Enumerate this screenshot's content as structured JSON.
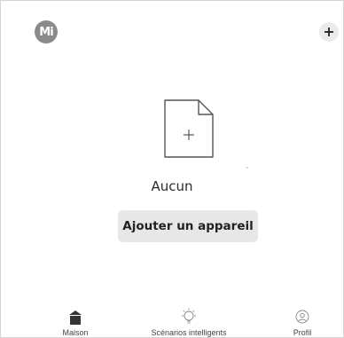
{
  "header": {
    "avatar_initials": "Mi",
    "add_icon": "plus-icon"
  },
  "empty_state": {
    "icon": "new-file-icon",
    "title": "Aucun",
    "button_label": "Ajouter un appareil"
  },
  "bottom_nav": {
    "items": [
      {
        "icon": "home-icon",
        "label": "Maison",
        "active": true
      },
      {
        "icon": "lightbulb-icon",
        "label": "Scénarios intelligents",
        "active": false
      },
      {
        "icon": "profile-icon",
        "label": "Profil",
        "active": false
      }
    ]
  },
  "colors": {
    "avatar_bg": "#8a8a8a",
    "button_bg": "#e7e7e7",
    "icon_stroke": "#555555"
  }
}
